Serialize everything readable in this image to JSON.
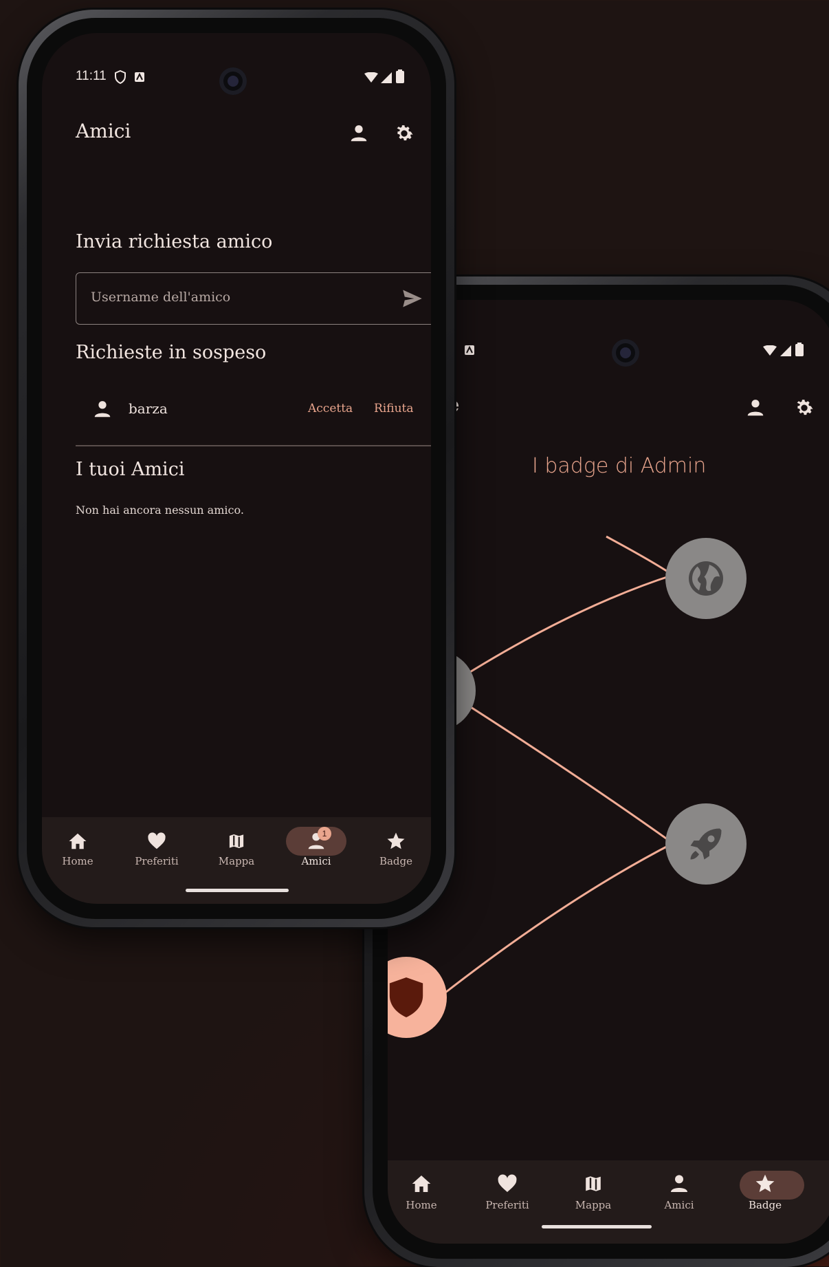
{
  "phone1": {
    "status": {
      "time": "11:11"
    },
    "app_bar": {
      "title": "Amici"
    },
    "send_request": {
      "heading": "Invia richiesta amico",
      "input_placeholder": "Username dell'amico"
    },
    "pending": {
      "heading": "Richieste in sospeso",
      "items": [
        {
          "username": "barza",
          "accept_label": "Accetta",
          "reject_label": "Rifiuta"
        }
      ]
    },
    "friends": {
      "heading": "I tuoi Amici",
      "empty_text": "Non hai ancora nessun amico."
    },
    "nav": {
      "items": [
        {
          "label": "Home",
          "icon": "home-icon"
        },
        {
          "label": "Preferiti",
          "icon": "heart-icon"
        },
        {
          "label": "Mappa",
          "icon": "map-icon"
        },
        {
          "label": "Amici",
          "icon": "person-icon",
          "badge": "1",
          "selected": true
        },
        {
          "label": "Badge",
          "icon": "star-icon"
        }
      ]
    }
  },
  "phone2": {
    "app_bar": {
      "title_partial": "ge"
    },
    "badge_heading": "I badge di Admin",
    "badges": [
      {
        "icon": "globe-icon",
        "unlocked": false
      },
      {
        "icon": "fire-icon",
        "unlocked": false
      },
      {
        "icon": "rocket-icon",
        "unlocked": false
      },
      {
        "icon": "shield-icon",
        "unlocked": true
      }
    ],
    "nav": {
      "items": [
        {
          "label": "Home",
          "icon": "home-icon"
        },
        {
          "label": "Preferiti",
          "icon": "heart-icon"
        },
        {
          "label": "Mappa",
          "icon": "map-icon"
        },
        {
          "label": "Amici",
          "icon": "person-icon"
        },
        {
          "label": "Badge",
          "icon": "star-icon",
          "selected": true
        }
      ]
    }
  },
  "colors": {
    "accent": "#e9a58d",
    "screen_bg": "#171011",
    "nav_bg": "#231b1a",
    "locked_badge": "#8a8887",
    "unlocked_badge": "#f7b39c"
  }
}
